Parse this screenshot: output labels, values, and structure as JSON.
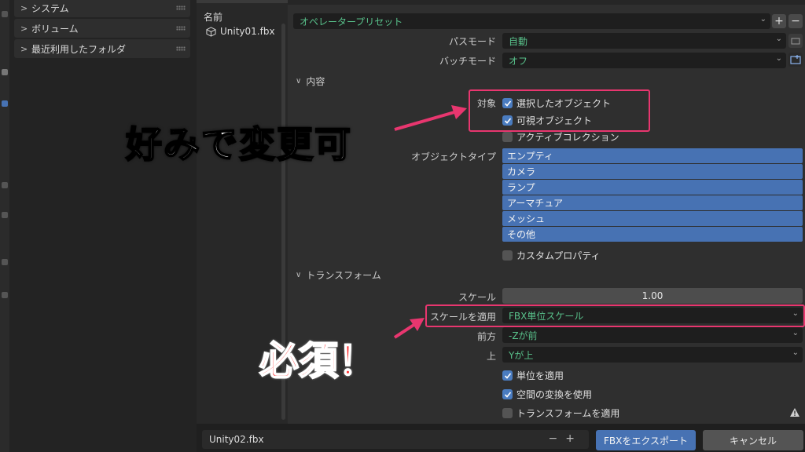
{
  "sidebar": {
    "items": [
      {
        "label": "システム"
      },
      {
        "label": "ボリューム"
      },
      {
        "label": "最近利用したフォルダ"
      }
    ]
  },
  "file_list": {
    "column_header": "名前",
    "files": [
      {
        "name": "Unity01.fbx"
      }
    ]
  },
  "settings": {
    "preset": {
      "value": "オペレータープリセット"
    },
    "path_mode": {
      "label": "パスモード",
      "value": "自動"
    },
    "batch_mode": {
      "label": "バッチモード",
      "value": "オフ"
    },
    "include": {
      "header": "内容",
      "target_label": "対象",
      "selected_objects": {
        "label": "選択したオブジェクト",
        "checked": true
      },
      "visible_objects": {
        "label": "可視オブジェクト",
        "checked": true
      },
      "active_collection": {
        "label": "アクティブコレクション",
        "checked": false
      },
      "object_types_label": "オブジェクトタイプ",
      "object_types": [
        "エンプティ",
        "カメラ",
        "ランプ",
        "アーマチュア",
        "メッシュ",
        "その他"
      ],
      "custom_properties": {
        "label": "カスタムプロパティ",
        "checked": false
      }
    },
    "transform": {
      "header": "トランスフォーム",
      "scale": {
        "label": "スケール",
        "value": "1.00"
      },
      "apply_scalings": {
        "label": "スケールを適用",
        "value": "FBX単位スケール"
      },
      "forward": {
        "label": "前方",
        "value": "-Zが前"
      },
      "up": {
        "label": "上",
        "value": "Yが上"
      },
      "apply_unit": {
        "label": "単位を適用",
        "checked": true
      },
      "space_transform": {
        "label": "空間の変換を使用",
        "checked": true
      },
      "apply_transform": {
        "label": "トランスフォームを適用",
        "checked": false
      }
    }
  },
  "bottom": {
    "filename": "Unity02.fbx",
    "export_label": "FBXをエクスポート",
    "cancel_label": "キャンセル"
  },
  "annotations": {
    "top_text": "好みで変更可",
    "bottom_text": "必須！",
    "highlight_color": "#e8366f"
  },
  "colors": {
    "accent": "#4772b3",
    "value_green": "#58c08a"
  }
}
